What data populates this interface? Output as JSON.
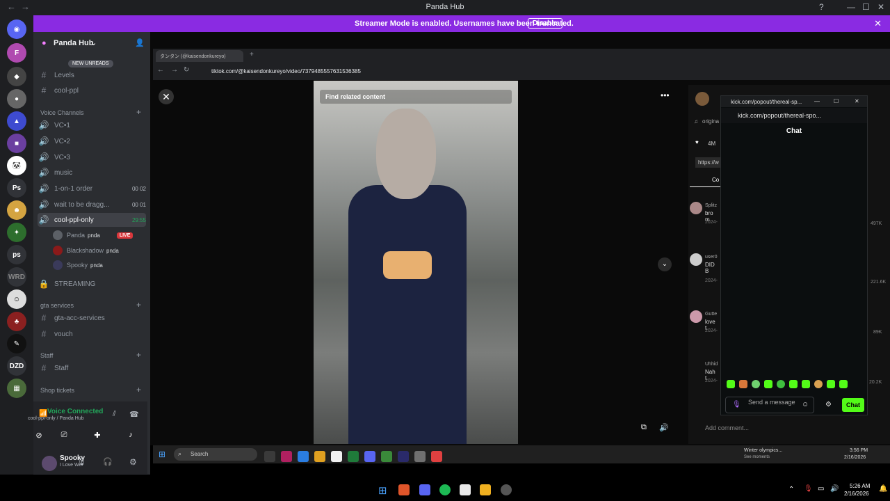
{
  "window": {
    "title": "Panda Hub"
  },
  "banner": {
    "message": "Streamer Mode is enabled. Usernames have been truncated.",
    "button": "Disable"
  },
  "server": {
    "name": "Panda Hub",
    "new_unreads": "NEW UNREADS"
  },
  "channels": {
    "top": [
      {
        "sym": "#",
        "label": "Levels"
      },
      {
        "sym": "#",
        "label": "cool-ppl"
      }
    ],
    "voice_category": "Voice Channels",
    "voice": [
      {
        "label": "VC•1"
      },
      {
        "label": "VC•2"
      },
      {
        "label": "VC•3"
      },
      {
        "label": "music"
      },
      {
        "label": "1-on-1 order",
        "meta": "00  02"
      },
      {
        "label": "wait to be dragg...",
        "meta": "00  01"
      },
      {
        "label": "cool-ppl-only",
        "meta": "29:55"
      }
    ],
    "members": [
      {
        "name": "Panda",
        "tag": "pnda",
        "live": "LIVE"
      },
      {
        "name": "Blackshadow",
        "tag": "pnda"
      },
      {
        "name": "Spooky",
        "tag": "pnda"
      }
    ],
    "streaming": "STREAMING",
    "gta_category": "gta services",
    "gta": [
      {
        "label": "gta-acc-services"
      },
      {
        "label": "vouch"
      }
    ],
    "staff_category": "Staff",
    "staff": [
      {
        "label": "Staff"
      }
    ],
    "shop_category": "Shop tickets"
  },
  "voice_panel": {
    "status": "Voice Connected",
    "location": "cool-ppl-only / Panda Hub"
  },
  "user": {
    "name": "Spooky",
    "status": "I Love We"
  },
  "browser": {
    "tab_title": "タンタン (@kaisendonkureyo)",
    "url": "tiktok.com/@kaisendonkureyo/video/7379485557631536385"
  },
  "video": {
    "find_related": "Find related content"
  },
  "tiktok_panel": {
    "original": "origina",
    "likes": "4M",
    "link": "https://w",
    "comments_tab": "Co",
    "comments": [
      {
        "user": "Splitz",
        "text": "bro m",
        "date": "2024-",
        "count": "497K"
      },
      {
        "user": "user0",
        "text": "DID B",
        "date": "2024-",
        "count": "221.6K"
      },
      {
        "user": "Gutte",
        "text": "love t",
        "date": "2024-",
        "count": "89K"
      },
      {
        "user": "Uhhid",
        "text": "Nah t",
        "date": "2024-",
        "count": "20.2K"
      }
    ],
    "add_comment": "Add comment..."
  },
  "kick": {
    "window_title": "kick.com/popout/thereal-sp...",
    "address": "kick.com/popout/thereal-spo...",
    "chat_header": "Chat",
    "send_placeholder": "Send a message",
    "chat_button": "Chat"
  },
  "taskbar_inner": {
    "search": "Search",
    "weather": "Winter olympics...",
    "weather_sub": "See moments",
    "time": "3:56 PM",
    "date": "2/16/2026"
  },
  "taskbar_outer": {
    "time": "5:26 AM",
    "date": "2/16/2026"
  },
  "colors": {
    "streamer_banner": "#8a2be2",
    "kick_green": "#53fc18",
    "live_red": "#da373c"
  }
}
